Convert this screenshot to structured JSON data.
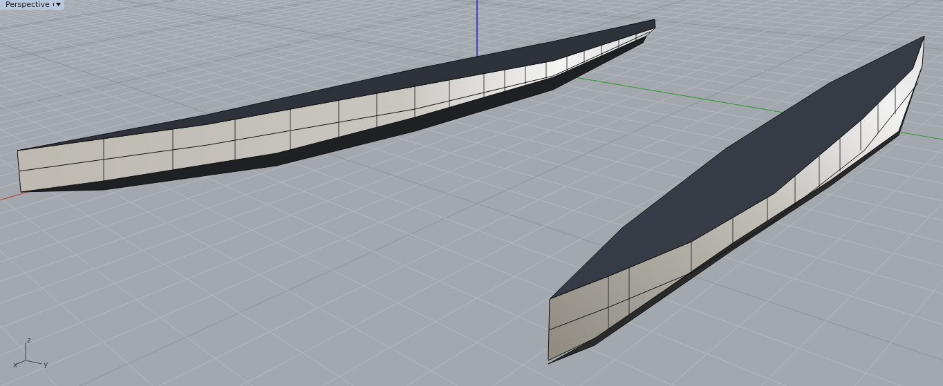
{
  "viewport": {
    "tab": {
      "label": "Perspective"
    },
    "axis_labels": {
      "z": "z",
      "x": "x",
      "y": "y"
    }
  }
}
